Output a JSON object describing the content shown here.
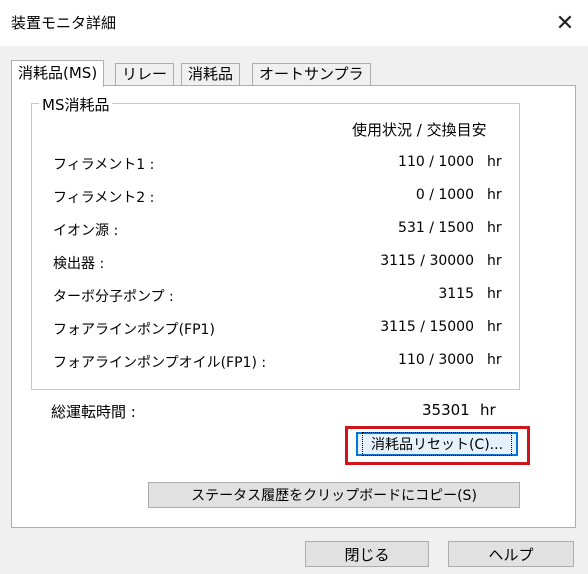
{
  "window": {
    "title": "装置モニタ詳細",
    "close_glyph": "✕"
  },
  "tabs": [
    {
      "label": "消耗品(MS)",
      "active": true
    },
    {
      "label": "リレー",
      "active": false
    },
    {
      "label": "消耗品",
      "active": false
    },
    {
      "label": "オートサンプラ",
      "active": false
    }
  ],
  "group": {
    "legend": "MS消耗品",
    "column_header": "使用状況 / 交換目安",
    "items": [
      {
        "label": "フィラメント1 :",
        "value": "110 / 1000",
        "unit": "hr"
      },
      {
        "label": "フィラメント2 :",
        "value": "0 / 1000",
        "unit": "hr"
      },
      {
        "label": "イオン源 :",
        "value": "531 / 1500",
        "unit": "hr"
      },
      {
        "label": "検出器 :",
        "value": "3115 / 30000",
        "unit": "hr"
      },
      {
        "label": "ターボ分子ポンプ :",
        "value": "3115",
        "unit": "hr"
      },
      {
        "label": "フォアラインポンプ(FP1)",
        "value": "3115 / 15000",
        "unit": "hr"
      },
      {
        "label": "フォアラインポンプオイル(FP1) :",
        "value": "110 / 3000",
        "unit": "hr"
      }
    ]
  },
  "total": {
    "label": "総運転時間 :",
    "value": "35301",
    "unit": "hr"
  },
  "buttons": {
    "reset": "消耗品リセット(C)...",
    "copy_history": "ステータス履歴をクリップボードにコピー(S)",
    "close": "閉じる",
    "help": "ヘルプ"
  },
  "colors": {
    "highlight": "#d0141c",
    "focus": "#0078d7"
  }
}
